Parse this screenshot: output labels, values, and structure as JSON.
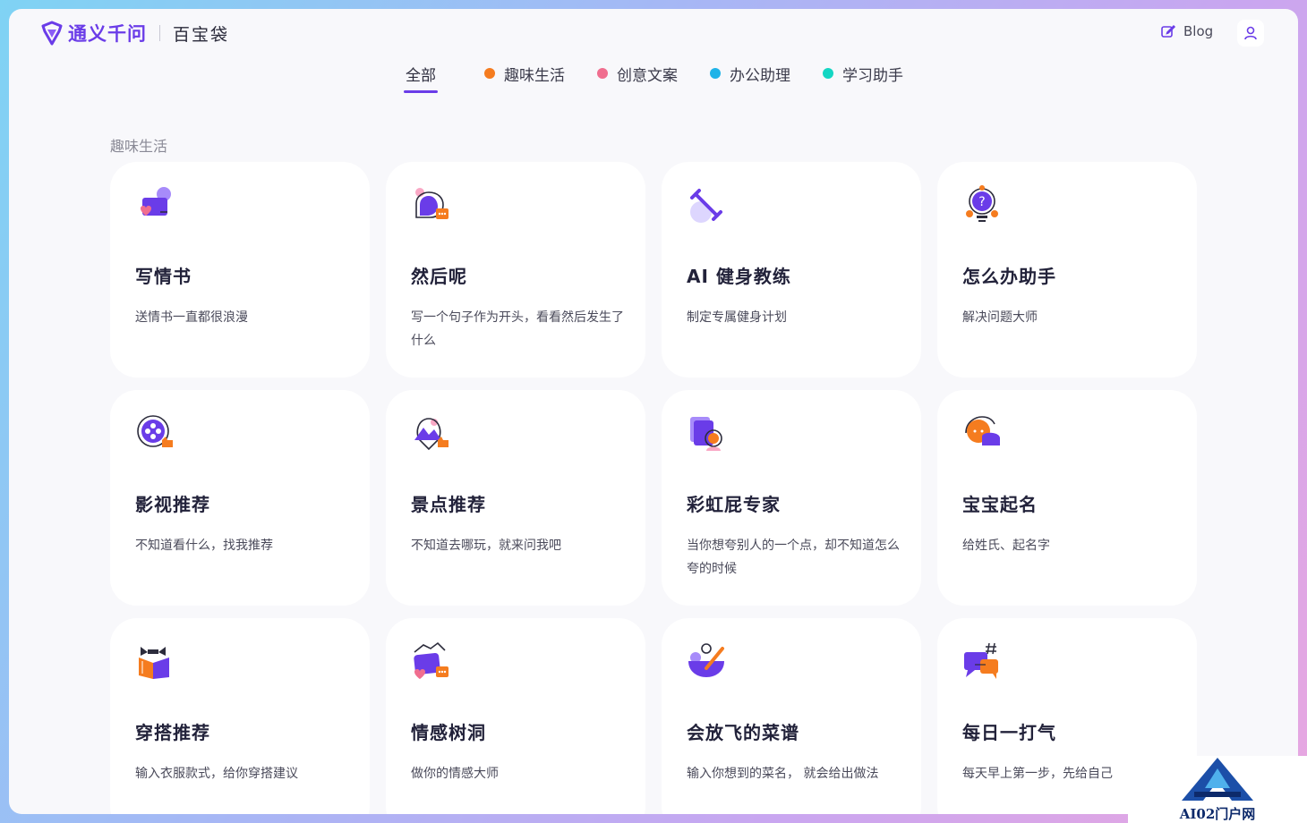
{
  "header": {
    "logo_text": "通义千问",
    "product_name": "百宝袋",
    "blog_label": "Blog"
  },
  "tabs": [
    {
      "label": "全部",
      "active": true,
      "dot_color": ""
    },
    {
      "label": "趣味生活",
      "active": false,
      "dot_color": "#f57c1f"
    },
    {
      "label": "创意文案",
      "active": false,
      "dot_color": "#f06e8f"
    },
    {
      "label": "办公助理",
      "active": false,
      "dot_color": "#1fb3e8"
    },
    {
      "label": "学习助手",
      "active": false,
      "dot_color": "#14d6c3"
    }
  ],
  "section": {
    "title": "趣味生活"
  },
  "cards": [
    {
      "title": "写情书",
      "desc": "送情书一直都很浪漫",
      "icon": "love-letter-icon"
    },
    {
      "title": "然后呢",
      "desc": "写一个句子作为开头，看看然后发生了什么",
      "icon": "chat-bubble-icon"
    },
    {
      "title": "AI 健身教练",
      "desc": "制定专属健身计划",
      "icon": "dumbbell-icon"
    },
    {
      "title": "怎么办助手",
      "desc": "解决问题大师",
      "icon": "lightbulb-question-icon"
    },
    {
      "title": "影视推荐",
      "desc": "不知道看什么，找我推荐",
      "icon": "film-reel-icon"
    },
    {
      "title": "景点推荐",
      "desc": "不知道去哪玩，就来问我吧",
      "icon": "map-pin-icon"
    },
    {
      "title": "彩虹屁专家",
      "desc": "当你想夸别人的一个点，却不知道怎么夸的时候",
      "icon": "praise-card-icon"
    },
    {
      "title": "宝宝起名",
      "desc": "给姓氏、起名字",
      "icon": "baby-icon"
    },
    {
      "title": "穿搭推荐",
      "desc": "输入衣服款式，给你穿搭建议",
      "icon": "outfit-icon"
    },
    {
      "title": "情感树洞",
      "desc": "做你的情感大师",
      "icon": "heart-chat-icon"
    },
    {
      "title": "会放飞的菜谱",
      "desc": "输入你想到的菜名， 就会给出做法",
      "icon": "cooking-bowl-icon"
    },
    {
      "title": "每日一打气",
      "desc": "每天早上第一步，先给自己",
      "icon": "hashtag-chat-icon"
    }
  ],
  "watermark": {
    "text": "AI02门户网"
  },
  "colors": {
    "accent": "#6a3ce8",
    "orange": "#f57c1f",
    "pink": "#f06e8f"
  }
}
